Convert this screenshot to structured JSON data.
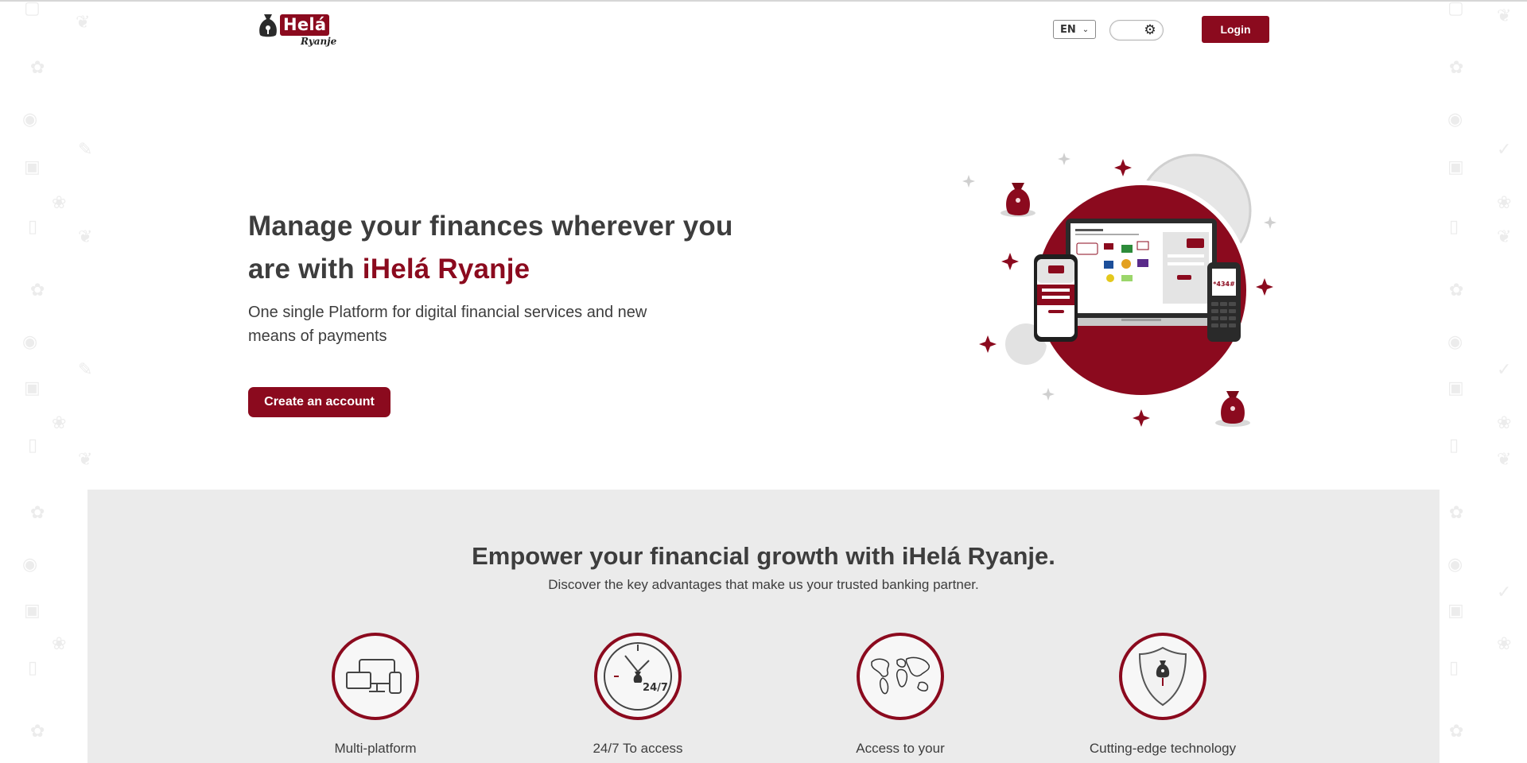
{
  "header": {
    "logo_word": "Helá",
    "logo_sub": "Ryanje",
    "language": "EN",
    "login_label": "Login"
  },
  "hero": {
    "title_line": "Manage your finances wherever you are with",
    "title_brand": "iHelá Ryanje",
    "subtitle": "One single Platform for digital financial services and new means of payments",
    "cta_label": "Create an account",
    "phone_screen_text": "*434#"
  },
  "features": {
    "title": "Empower your financial growth with iHelá Ryanje.",
    "subtitle": "Discover the key advantages that make us your trusted banking partner.",
    "items": [
      {
        "label": "Multi-platform",
        "icon": "devices-icon"
      },
      {
        "label": "24/7 To access",
        "icon": "clock-24-7-icon",
        "badge": "24/7"
      },
      {
        "label": "Access to your",
        "icon": "world-map-icon"
      },
      {
        "label": "Cutting-edge technology",
        "icon": "shield-icon"
      }
    ]
  },
  "colors": {
    "brand": "#8b0a1e",
    "text": "#3d3d3d",
    "section_bg": "#ebebeb"
  }
}
